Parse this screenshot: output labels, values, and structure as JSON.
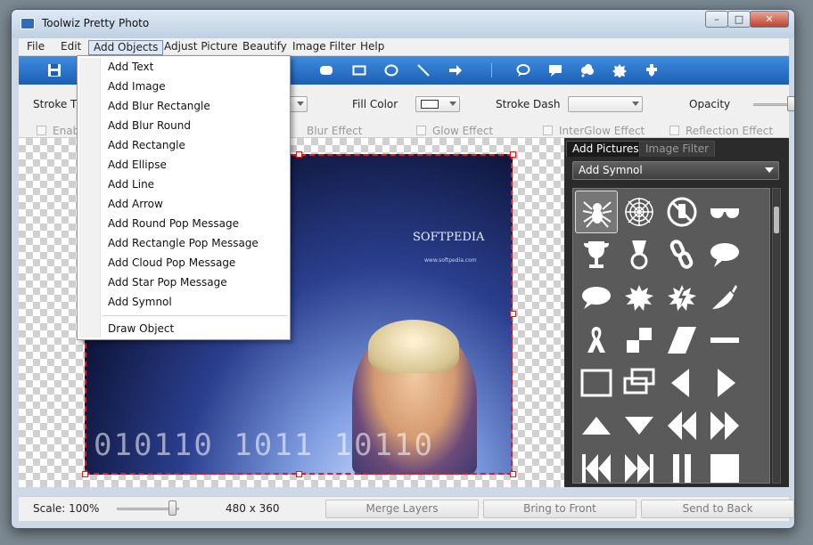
{
  "window": {
    "title": "Toolwiz Pretty Photo"
  },
  "menubar": {
    "items": [
      "File",
      "Edit",
      "Add Objects",
      "Adjust Picture",
      "Beautify",
      "Image Filter",
      "Help"
    ],
    "active_index": 2
  },
  "toolbar": {
    "icons": [
      "save-icon",
      "rounded-rectangle-icon",
      "rectangle-icon",
      "ellipse-icon",
      "line-icon",
      "arrow-icon",
      "round-pop-icon",
      "rect-pop-icon",
      "cloud-pop-icon",
      "star-pop-icon",
      "symbol-icon"
    ],
    "accent": "#2a72cc"
  },
  "properties": {
    "stroke_thickness_label": "Stroke Thick",
    "fill_color_label": "Fill Color",
    "stroke_dash_label": "Stroke Dash",
    "opacity_label": "Opacity",
    "effects": [
      "Enable S",
      "Blur Effect",
      "Glow Effect",
      "InterGlow Effect",
      "Reflection Effect"
    ]
  },
  "dropdown": {
    "items": [
      "Add Text",
      "Add Image",
      "Add Blur Rectangle",
      "Add Blur Round",
      "Add Rectangle",
      "Add Ellipse",
      "Add Line",
      "Add Arrow",
      "Add Round Pop Message",
      "Add Rectangle Pop Message",
      "Add Cloud Pop Message",
      "Add Star Pop Message",
      "Add Symnol"
    ],
    "footer_item": "Draw Object"
  },
  "image": {
    "watermark": "SOFTPEDIA",
    "url": "www.softpedia.com",
    "binary_text": "010110 1011 10110",
    "selection_color": "#e81919"
  },
  "panel": {
    "tabs": [
      "Add Pictures",
      "Image Filter"
    ],
    "active_tab": 0,
    "select_value": "Add Symnol",
    "symbols": [
      "spider",
      "spiderweb",
      "no-phone",
      "sunglasses",
      "trophy",
      "medal",
      "chain-link",
      "speech-bubble",
      "speech-bubble-2",
      "burst",
      "burst-lightning",
      "pepper",
      "ribbon",
      "step-squares",
      "parallelogram",
      "dash-line",
      "rectangle-outline",
      "double-rectangle",
      "triangle-left",
      "triangle-right",
      "triangle-up",
      "triangle-down",
      "double-left",
      "double-right",
      "skip-left",
      "skip-right",
      "pause-bars",
      "square"
    ]
  },
  "statusbar": {
    "scale_label": "Scale: 100%",
    "dimensions": "480 x 360",
    "merge_layers": "Merge Layers",
    "bring_to_front": "Bring to Front",
    "send_to_back": "Send to Back"
  }
}
